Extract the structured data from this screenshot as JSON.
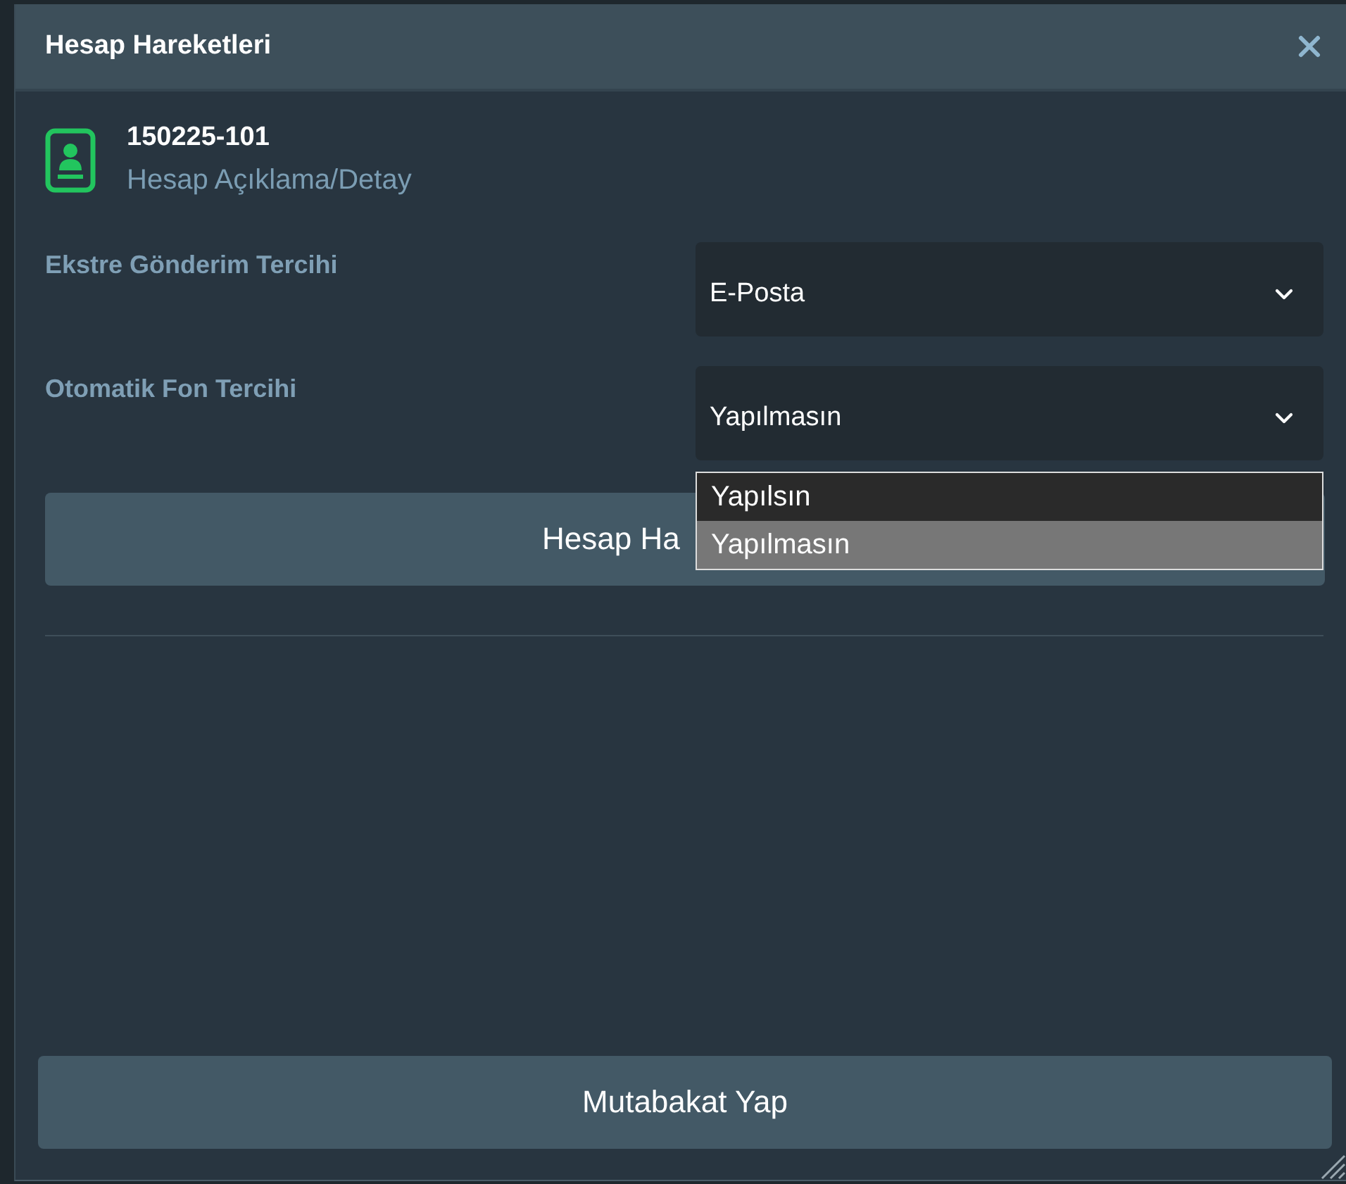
{
  "dialog": {
    "title": "Hesap Hareketleri"
  },
  "account": {
    "number": "150225-101",
    "description": "Hesap Açıklama/Detay"
  },
  "fields": [
    {
      "label": "Ekstre Gönderim Tercihi",
      "value": "E-Posta"
    },
    {
      "label": "Otomatik Fon Tercihi",
      "value": "Yapılmasın",
      "open": true,
      "options": [
        {
          "label": "Yapılsın",
          "selected": false
        },
        {
          "label": "Yapılmasın",
          "selected": true
        }
      ]
    }
  ],
  "action_button": "Hesap Ha",
  "footer_button": "Mutabakat Yap"
}
